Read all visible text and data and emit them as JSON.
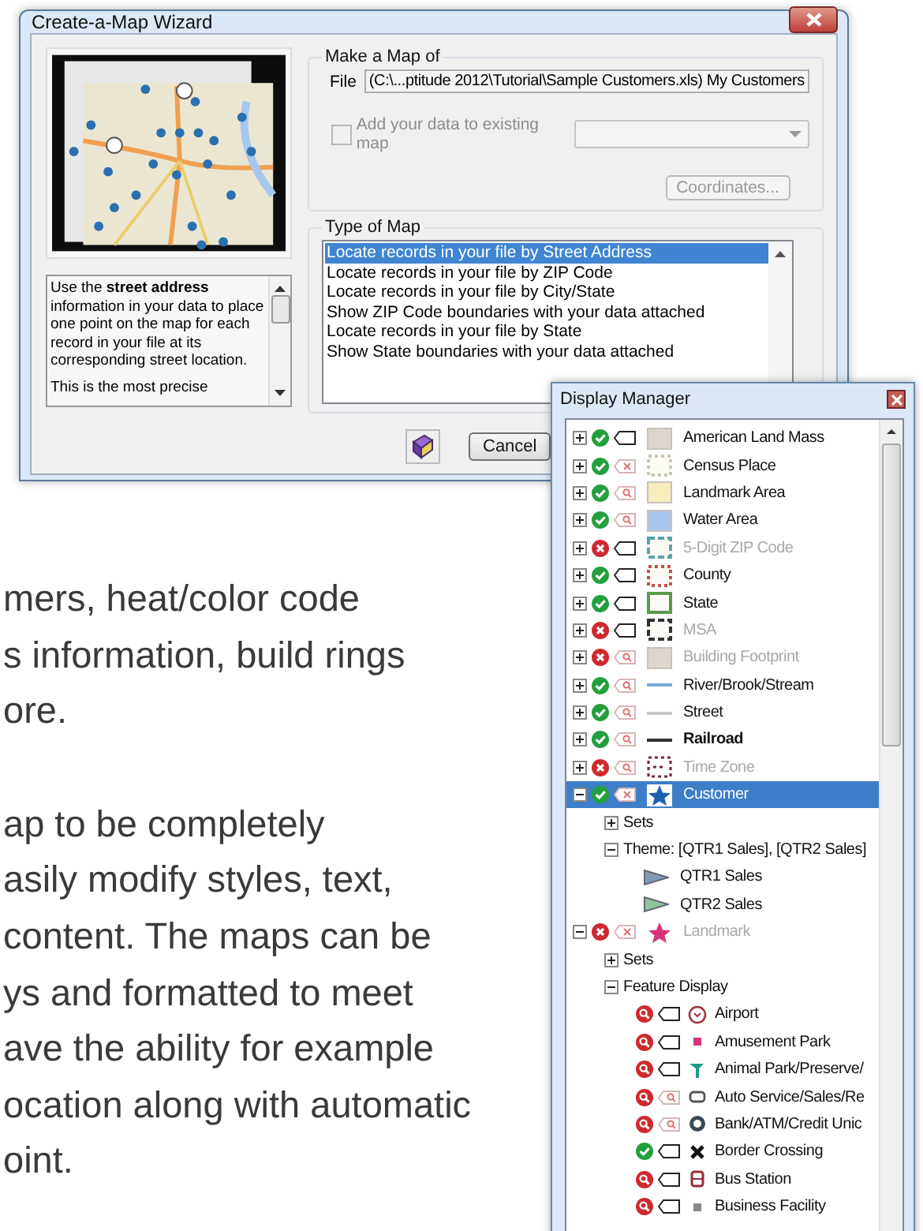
{
  "background_text": {
    "paragraphs": [
      [
        "mers, heat/color code",
        "s information, build rings",
        "ore."
      ],
      [
        "ap to be completely",
        "asily modify styles, text,",
        "content. The maps can be",
        "ys and formatted to meet",
        "ave the ability for example",
        "ocation along with automatic",
        "oint."
      ]
    ]
  },
  "wizard": {
    "title": "Create-a-Map Wizard",
    "description": [
      "Use the **street address** information in your data to place one point on the map for each record in your file at its corresponding street location.",
      "This is the most precise"
    ],
    "make_map": {
      "legend": "Make a Map of",
      "file_label": "File",
      "file_value": "(C:\\...ptitude 2012\\Tutorial\\Sample Customers.xls) My Customers",
      "add_to_existing": {
        "label": "Add your data to existing map",
        "checked": false,
        "disabled": true
      },
      "existing_map_dropdown": {
        "disabled": true
      },
      "coordinates_button": {
        "label": "Coordinates...",
        "disabled": true
      }
    },
    "type_of_map": {
      "legend": "Type of Map",
      "options": [
        {
          "label": "Locate records in your file by Street Address",
          "selected": true
        },
        {
          "label": "Locate records in your file by ZIP Code",
          "selected": false
        },
        {
          "label": "Locate records in your file by City/State",
          "selected": false
        },
        {
          "label": "Show ZIP Code boundaries with your data attached",
          "selected": false
        },
        {
          "label": "Locate records in your file by State",
          "selected": false
        },
        {
          "label": "Show State boundaries with your data attached",
          "selected": false
        }
      ]
    },
    "buttons": [
      {
        "kind": "help"
      },
      {
        "kind": "text",
        "label": "Cancel"
      }
    ]
  },
  "display_manager": {
    "title": "Display Manager",
    "layers": [
      {
        "kind": "layer",
        "name": "American Land Mass",
        "visible": true,
        "zoom_limited": false,
        "labels_on": true,
        "labels_zoom": false,
        "swatch": {
          "kind": "fill",
          "color": "#dcd6cf"
        },
        "bold": false,
        "selected": false,
        "expanded": false
      },
      {
        "kind": "layer",
        "name": "Census Place",
        "visible": true,
        "zoom_limited": false,
        "labels_on": false,
        "labels_zoom": false,
        "swatch": {
          "kind": "dotted",
          "color": "#c8c8b0"
        },
        "bold": false,
        "selected": false,
        "expanded": false
      },
      {
        "kind": "layer",
        "name": "Landmark Area",
        "visible": true,
        "zoom_limited": false,
        "labels_on": false,
        "labels_zoom": true,
        "swatch": {
          "kind": "fill",
          "color": "#f7edbd"
        },
        "bold": false,
        "selected": false,
        "expanded": false
      },
      {
        "kind": "layer",
        "name": "Water Area",
        "visible": true,
        "zoom_limited": false,
        "labels_on": false,
        "labels_zoom": true,
        "swatch": {
          "kind": "fill",
          "color": "#a7c7ec"
        },
        "bold": false,
        "selected": false,
        "expanded": false
      },
      {
        "kind": "layer",
        "name": "5-Digit ZIP Code",
        "visible": false,
        "zoom_limited": false,
        "labels_on": true,
        "labels_zoom": false,
        "swatch": {
          "kind": "dashed",
          "color": "#5aa3a8"
        },
        "bold": false,
        "selected": false,
        "expanded": false
      },
      {
        "kind": "layer",
        "name": "County",
        "visible": true,
        "zoom_limited": false,
        "labels_on": true,
        "labels_zoom": false,
        "swatch": {
          "kind": "dotted",
          "color": "#c0504d"
        },
        "bold": false,
        "selected": false,
        "expanded": false
      },
      {
        "kind": "layer",
        "name": "State",
        "visible": true,
        "zoom_limited": false,
        "labels_on": true,
        "labels_zoom": false,
        "swatch": {
          "kind": "outline",
          "color": "#5a9a4a"
        },
        "bold": false,
        "selected": false,
        "expanded": false
      },
      {
        "kind": "layer",
        "name": "MSA",
        "visible": false,
        "zoom_limited": false,
        "labels_on": true,
        "labels_zoom": false,
        "swatch": {
          "kind": "dashed",
          "color": "#333333"
        },
        "bold": false,
        "selected": false,
        "expanded": false
      },
      {
        "kind": "layer",
        "name": "Building Footprint",
        "visible": false,
        "zoom_limited": false,
        "labels_on": false,
        "labels_zoom": true,
        "swatch": {
          "kind": "fill",
          "color": "#dcd6cf"
        },
        "bold": false,
        "selected": false,
        "expanded": false
      },
      {
        "kind": "layer",
        "name": "River/Brook/Stream",
        "visible": true,
        "zoom_limited": false,
        "labels_on": false,
        "labels_zoom": true,
        "swatch": {
          "kind": "line",
          "color": "#7aa8d8"
        },
        "bold": false,
        "selected": false,
        "expanded": false
      },
      {
        "kind": "layer",
        "name": "Street",
        "visible": true,
        "zoom_limited": false,
        "labels_on": false,
        "labels_zoom": true,
        "swatch": {
          "kind": "line",
          "color": "#c8c8c8"
        },
        "bold": false,
        "selected": false,
        "expanded": false
      },
      {
        "kind": "layer",
        "name": "Railroad",
        "visible": true,
        "zoom_limited": false,
        "labels_on": false,
        "labels_zoom": true,
        "swatch": {
          "kind": "line",
          "color": "#333333"
        },
        "bold": true,
        "selected": false,
        "expanded": false
      },
      {
        "kind": "layer",
        "name": "Time Zone",
        "visible": false,
        "zoom_limited": false,
        "labels_on": false,
        "labels_zoom": true,
        "swatch": {
          "kind": "pattern",
          "color": "#7a2a3a"
        },
        "bold": false,
        "selected": false,
        "expanded": false
      },
      {
        "kind": "layer",
        "name": "Customer",
        "visible": true,
        "zoom_limited": false,
        "labels_on": false,
        "labels_zoom": false,
        "swatch": {
          "kind": "star",
          "color": "#1f5fb0"
        },
        "bold": false,
        "selected": true,
        "expanded": true,
        "children": [
          {
            "kind": "group",
            "name": "Sets",
            "expanded": false
          },
          {
            "kind": "group",
            "name": "Theme: [QTR1 Sales], [QTR2 Sales]",
            "expanded": true,
            "children": [
              {
                "kind": "theme",
                "name": "QTR1 Sales",
                "color": "#7f9ab5"
              },
              {
                "kind": "theme",
                "name": "QTR2 Sales",
                "color": "#8fc79a"
              }
            ]
          }
        ]
      },
      {
        "kind": "layer",
        "name": "Landmark",
        "visible": false,
        "zoom_limited": false,
        "labels_on": false,
        "labels_zoom": false,
        "swatch": {
          "kind": "star",
          "color": "#d6337a"
        },
        "bold": false,
        "selected": false,
        "expanded": true,
        "children": [
          {
            "kind": "group",
            "name": "Sets",
            "expanded": false
          },
          {
            "kind": "group",
            "name": "Feature Display",
            "expanded": true,
            "children": [
              {
                "kind": "feature",
                "name": "Airport",
                "visible": false,
                "zoom_limited": true,
                "labels_on": true,
                "labels_zoom": false,
                "color": "#9b3a3a"
              },
              {
                "kind": "feature",
                "name": "Amusement Park",
                "visible": false,
                "zoom_limited": true,
                "labels_on": true,
                "labels_zoom": false,
                "color": "#d6337a"
              },
              {
                "kind": "feature",
                "name": "Animal Park/Preserve/",
                "visible": false,
                "zoom_limited": true,
                "labels_on": true,
                "labels_zoom": false,
                "color": "#1f9a8a"
              },
              {
                "kind": "feature",
                "name": "Auto Service/Sales/Re",
                "visible": false,
                "zoom_limited": true,
                "labels_on": false,
                "labels_zoom": true,
                "color": "#555555"
              },
              {
                "kind": "feature",
                "name": "Bank/ATM/Credit Unic",
                "visible": false,
                "zoom_limited": true,
                "labels_on": false,
                "labels_zoom": true,
                "color": "#3a4a5a"
              },
              {
                "kind": "feature",
                "name": "Border Crossing",
                "visible": true,
                "zoom_limited": false,
                "labels_on": true,
                "labels_zoom": false,
                "color": "#111111"
              },
              {
                "kind": "feature",
                "name": "Bus Station",
                "visible": false,
                "zoom_limited": true,
                "labels_on": true,
                "labels_zoom": false,
                "color": "#9b2a3a"
              },
              {
                "kind": "feature",
                "name": "Business Facility",
                "visible": false,
                "zoom_limited": true,
                "labels_on": true,
                "labels_zoom": false,
                "color": "#888888"
              }
            ]
          }
        ]
      }
    ]
  }
}
